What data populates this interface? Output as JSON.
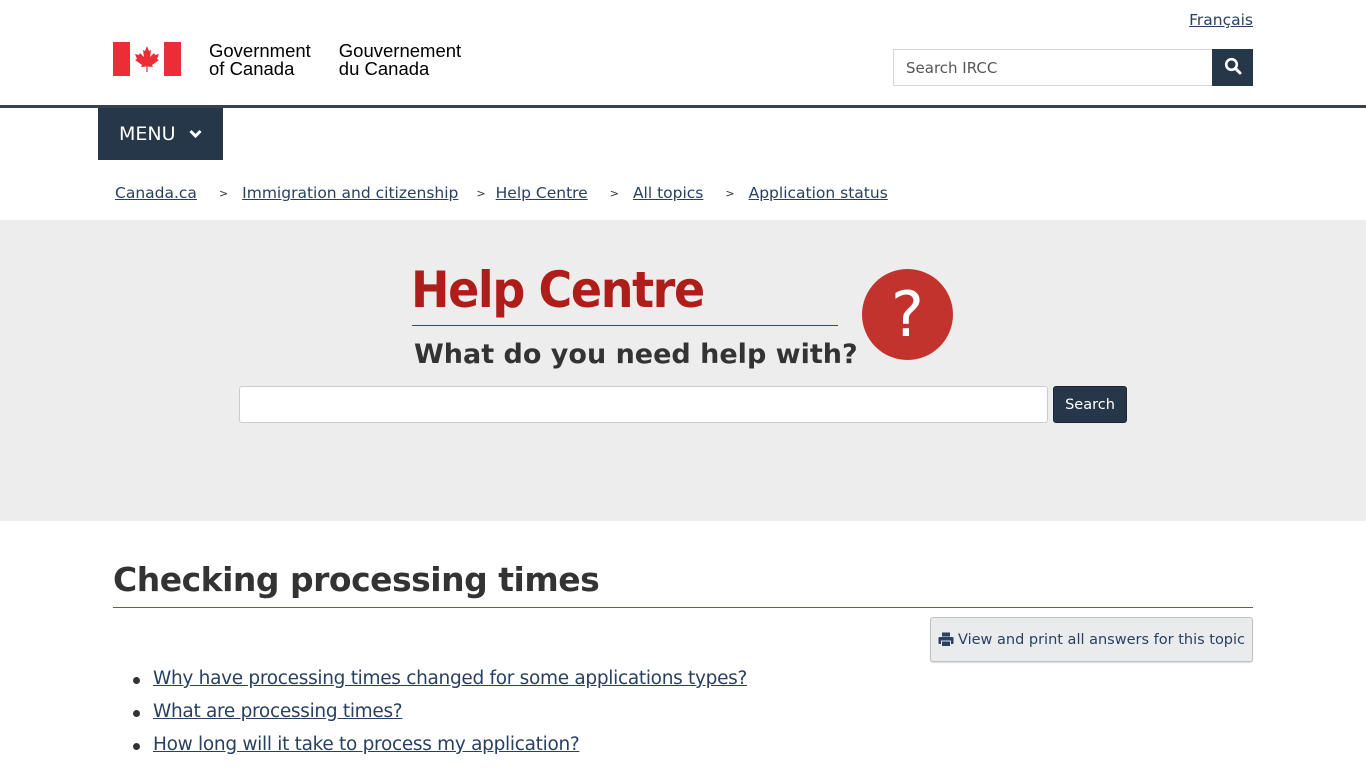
{
  "header": {
    "language_link": "Français",
    "signature_en_line1": "Government",
    "signature_en_line2": "of Canada",
    "signature_fr_line1": "Gouvernement",
    "signature_fr_line2": "du Canada",
    "search_placeholder": "Search IRCC",
    "search_icon": "magnifier-icon"
  },
  "menu": {
    "label": "MENU",
    "icon": "chevron-down-icon"
  },
  "breadcrumb": [
    {
      "label": "Canada.ca"
    },
    {
      "label": "Immigration and citizenship"
    },
    {
      "label": "Help Centre"
    },
    {
      "label": "All topics"
    },
    {
      "label": "Application status"
    }
  ],
  "breadcrumb_separator": ">",
  "hero": {
    "title": "Help Centre",
    "subtitle": "What do you need help with?",
    "help_icon_glyph": "?",
    "search_value": "",
    "search_button": "Search"
  },
  "content": {
    "topic_title": "Checking processing times",
    "print_button": "View and print all answers for this topic",
    "questions": [
      {
        "label": "Why have processing times changed for some applications types?"
      },
      {
        "label": "What are processing times?"
      },
      {
        "label": "How long will it take to process my application?"
      }
    ]
  },
  "colors": {
    "brand_dark": "#26374a",
    "link": "#284162",
    "accent_red": "#af1d1a",
    "flag_red": "#eb2d37",
    "hero_bg": "#ededed"
  }
}
